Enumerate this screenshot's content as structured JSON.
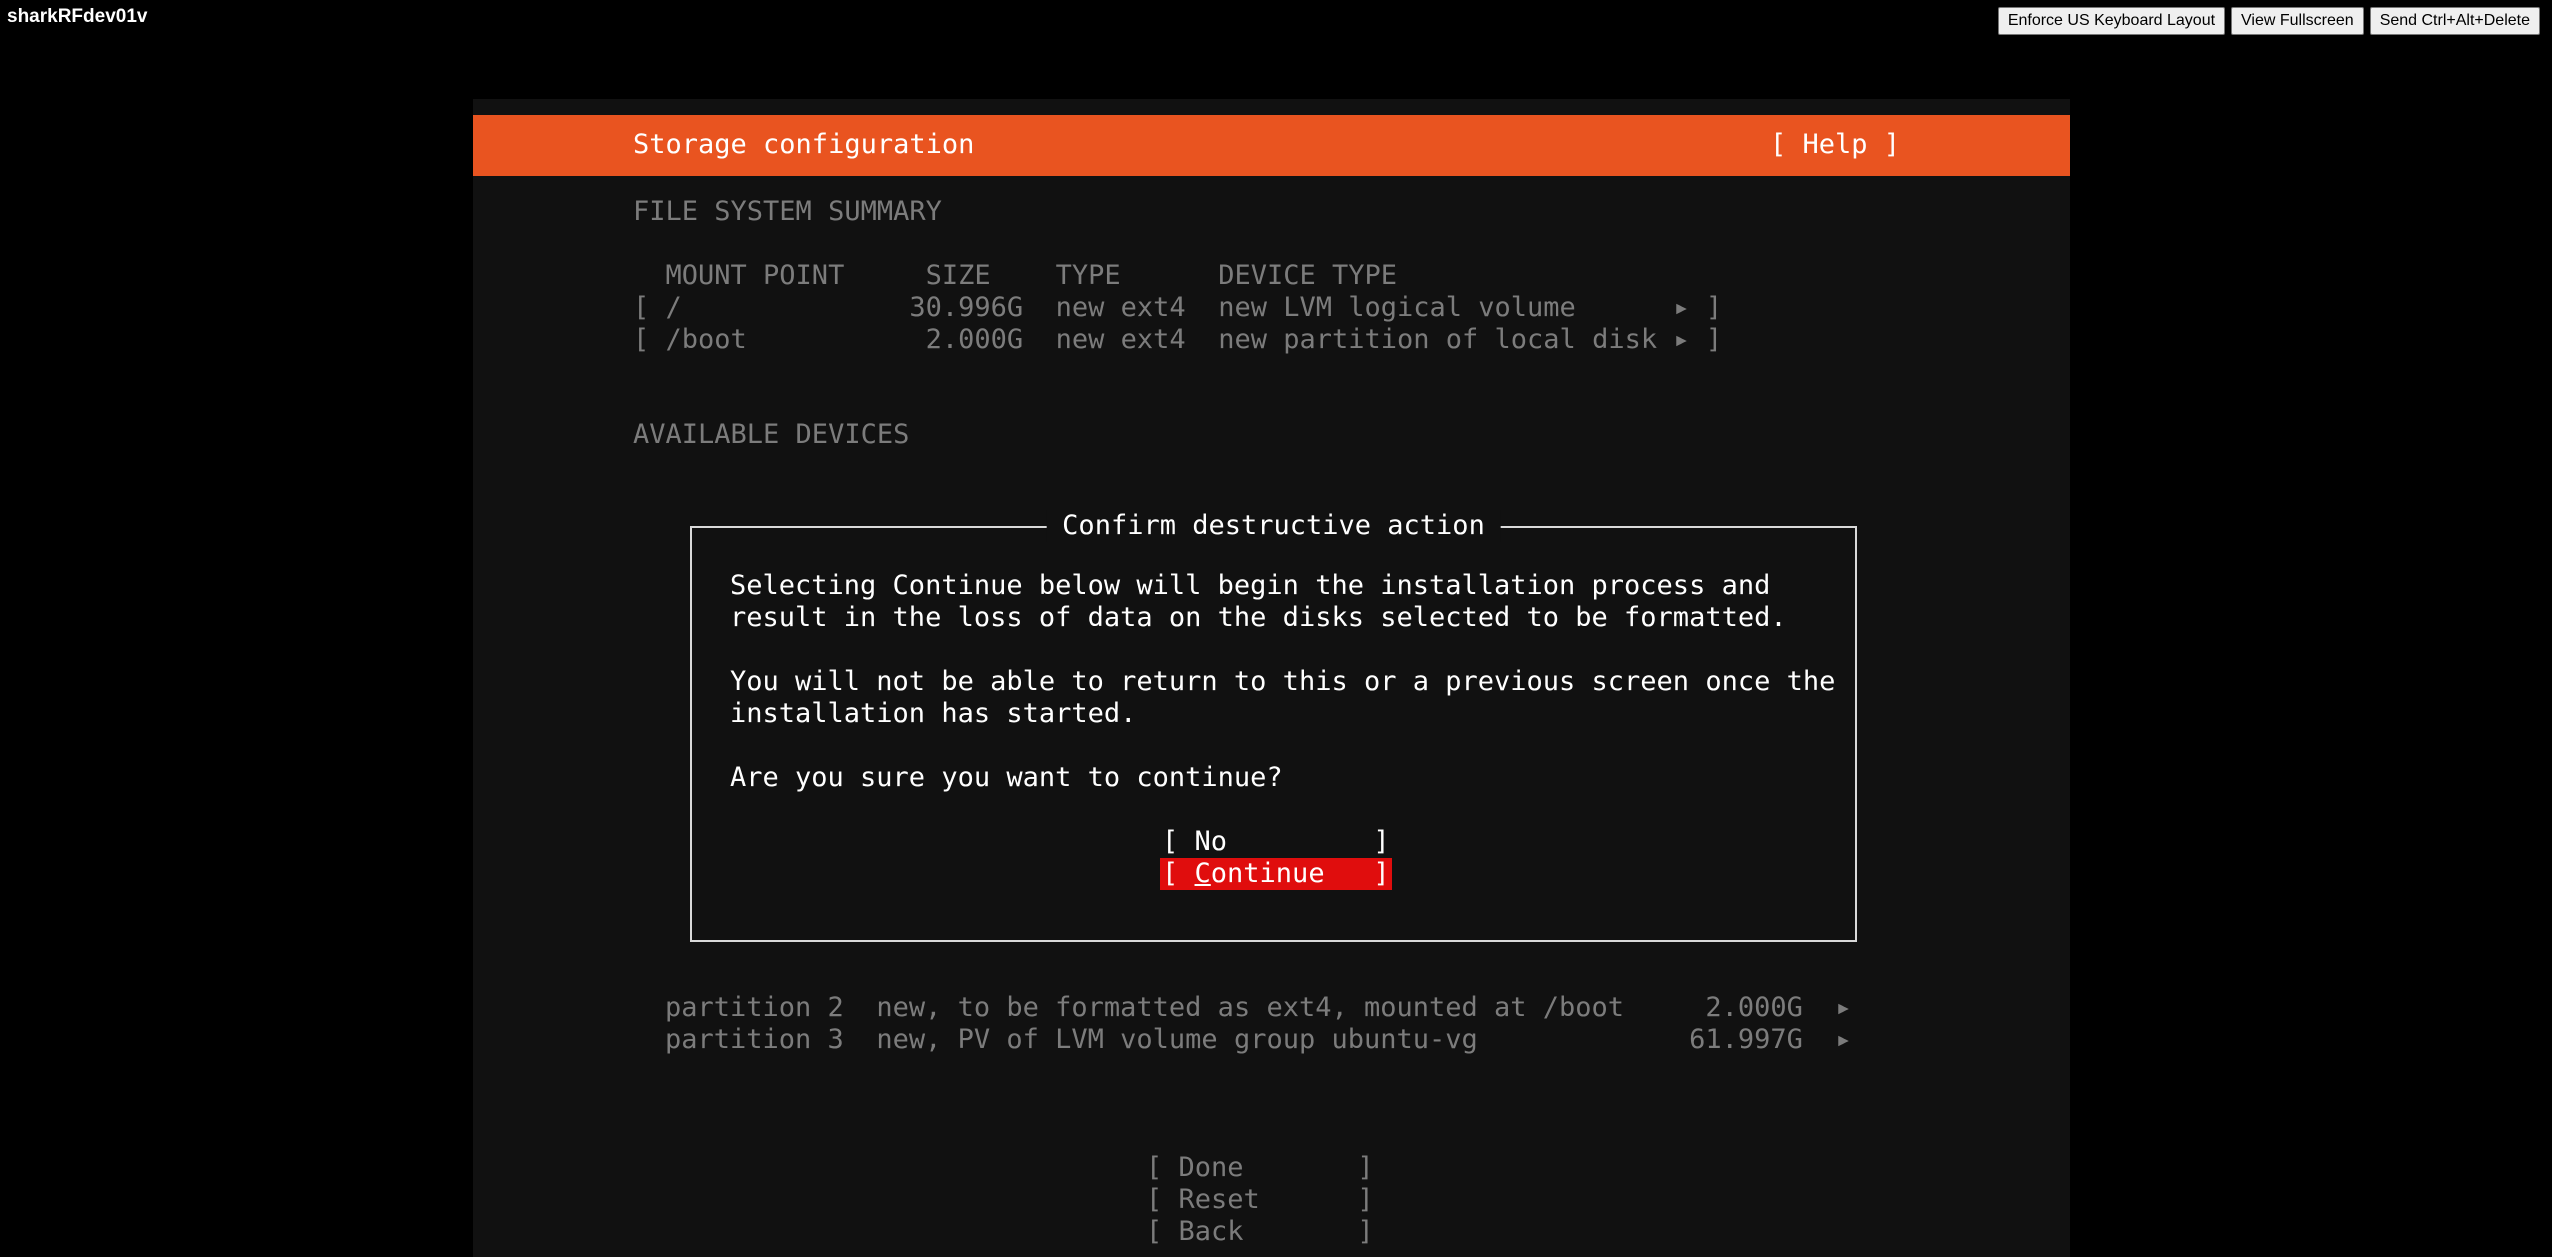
{
  "host": {
    "name": "sharkRFdev01v"
  },
  "toolbar": {
    "keyboard_label": "Enforce US Keyboard Layout",
    "fullscreen_label": "View Fullscreen",
    "cad_label": "Send Ctrl+Alt+Delete"
  },
  "installer": {
    "title": "Storage configuration",
    "help": "[ Help ]",
    "fs_summary_heading": "FILE SYSTEM SUMMARY",
    "fs_header": "  MOUNT POINT     SIZE    TYPE      DEVICE TYPE",
    "fs_rows": [
      "[ /              30.996G  new ext4  new LVM logical volume      ▸ ]",
      "[ /boot           2.000G  new ext4  new partition of local disk ▸ ]"
    ],
    "available_heading": "AVAILABLE DEVICES",
    "partition_rows": [
      "partition 2  new, to be formatted as ext4, mounted at /boot     2.000G  ▸",
      "partition 3  new, PV of LVM volume group ubuntu-vg             61.997G  ▸"
    ],
    "buttons": {
      "done": "[ Done       ]",
      "reset": "[ Reset      ]",
      "back": "[ Back       ]"
    }
  },
  "dialog": {
    "title": "Confirm destructive action",
    "lines": [
      "Selecting Continue below will begin the installation process and",
      "result in the loss of data on the disks selected to be formatted.",
      "You will not be able to return to this or a previous screen once the",
      "installation has started.",
      "Are you sure you want to continue?"
    ],
    "no_label": "[ No         ]",
    "continue_prefix": "[ ",
    "continue_hotkey": "C",
    "continue_rest": "ontinue   ]"
  }
}
